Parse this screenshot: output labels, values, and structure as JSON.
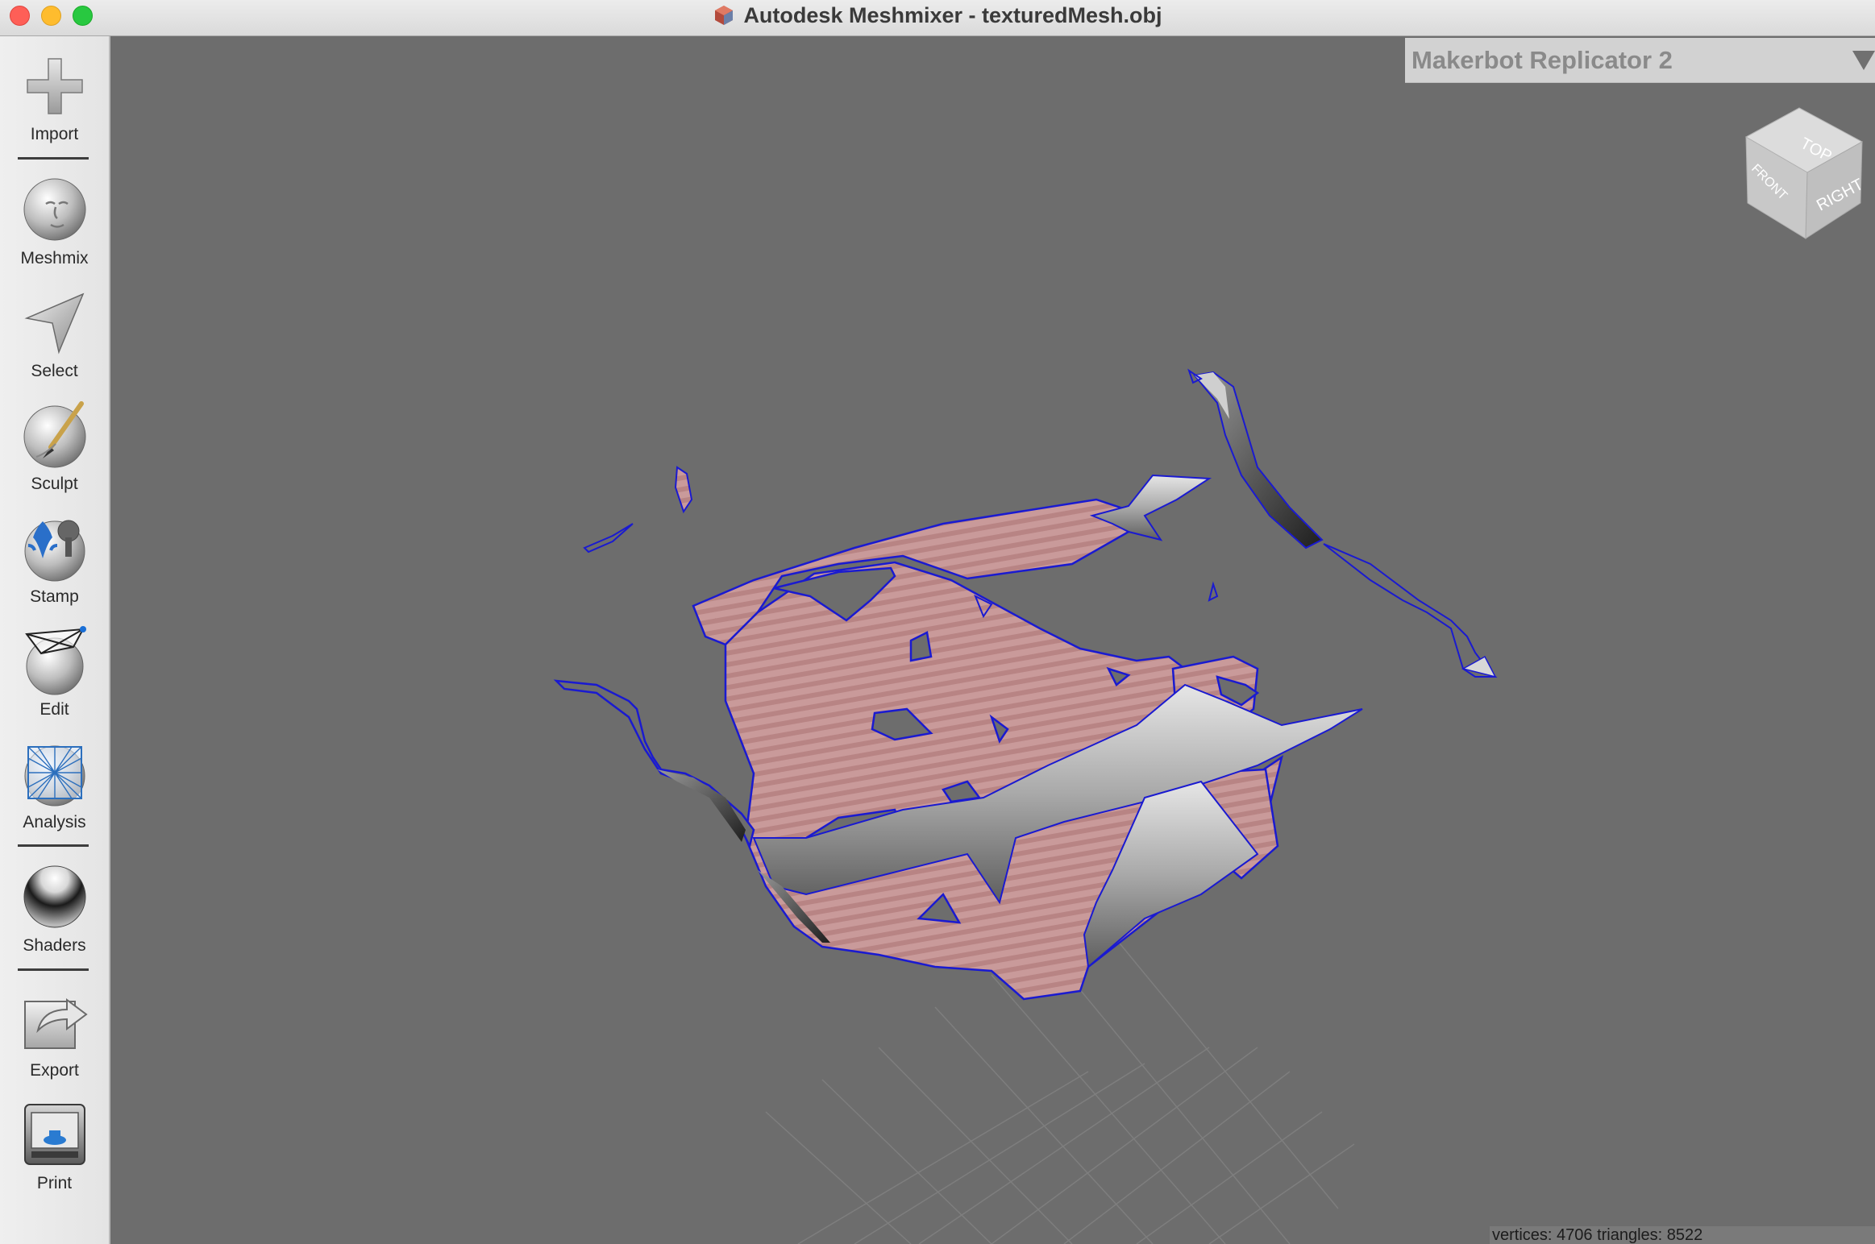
{
  "window": {
    "title": "Autodesk Meshmixer - texturedMesh.obj"
  },
  "sidebar": {
    "tools": [
      {
        "id": "import",
        "label": "Import",
        "icon": "plus-icon"
      },
      {
        "id": "meshmix",
        "label": "Meshmix",
        "icon": "face-sphere-icon"
      },
      {
        "id": "select",
        "label": "Select",
        "icon": "arrow-cursor-icon"
      },
      {
        "id": "sculpt",
        "label": "Sculpt",
        "icon": "brush-sphere-icon"
      },
      {
        "id": "stamp",
        "label": "Stamp",
        "icon": "stamp-sphere-icon"
      },
      {
        "id": "edit",
        "label": "Edit",
        "icon": "wireframe-sphere-icon"
      },
      {
        "id": "analysis",
        "label": "Analysis",
        "icon": "mesh-sphere-icon"
      },
      {
        "id": "shaders",
        "label": "Shaders",
        "icon": "chrome-sphere-icon"
      },
      {
        "id": "export",
        "label": "Export",
        "icon": "export-arrow-icon"
      },
      {
        "id": "print",
        "label": "Print",
        "icon": "printer-icon"
      }
    ]
  },
  "viewport": {
    "printer": "Makerbot Replicator 2",
    "viewcube": {
      "top": "TOP",
      "front": "FRONT",
      "right": "RIGHT"
    },
    "status": "vertices: 4706 triangles: 8522"
  },
  "colors": {
    "viewport_bg": "#6d6d6d",
    "mesh_outline": "#1a1ad0",
    "mesh_texture": "#c99a9a",
    "mesh_surface": "#bdbdbd"
  }
}
